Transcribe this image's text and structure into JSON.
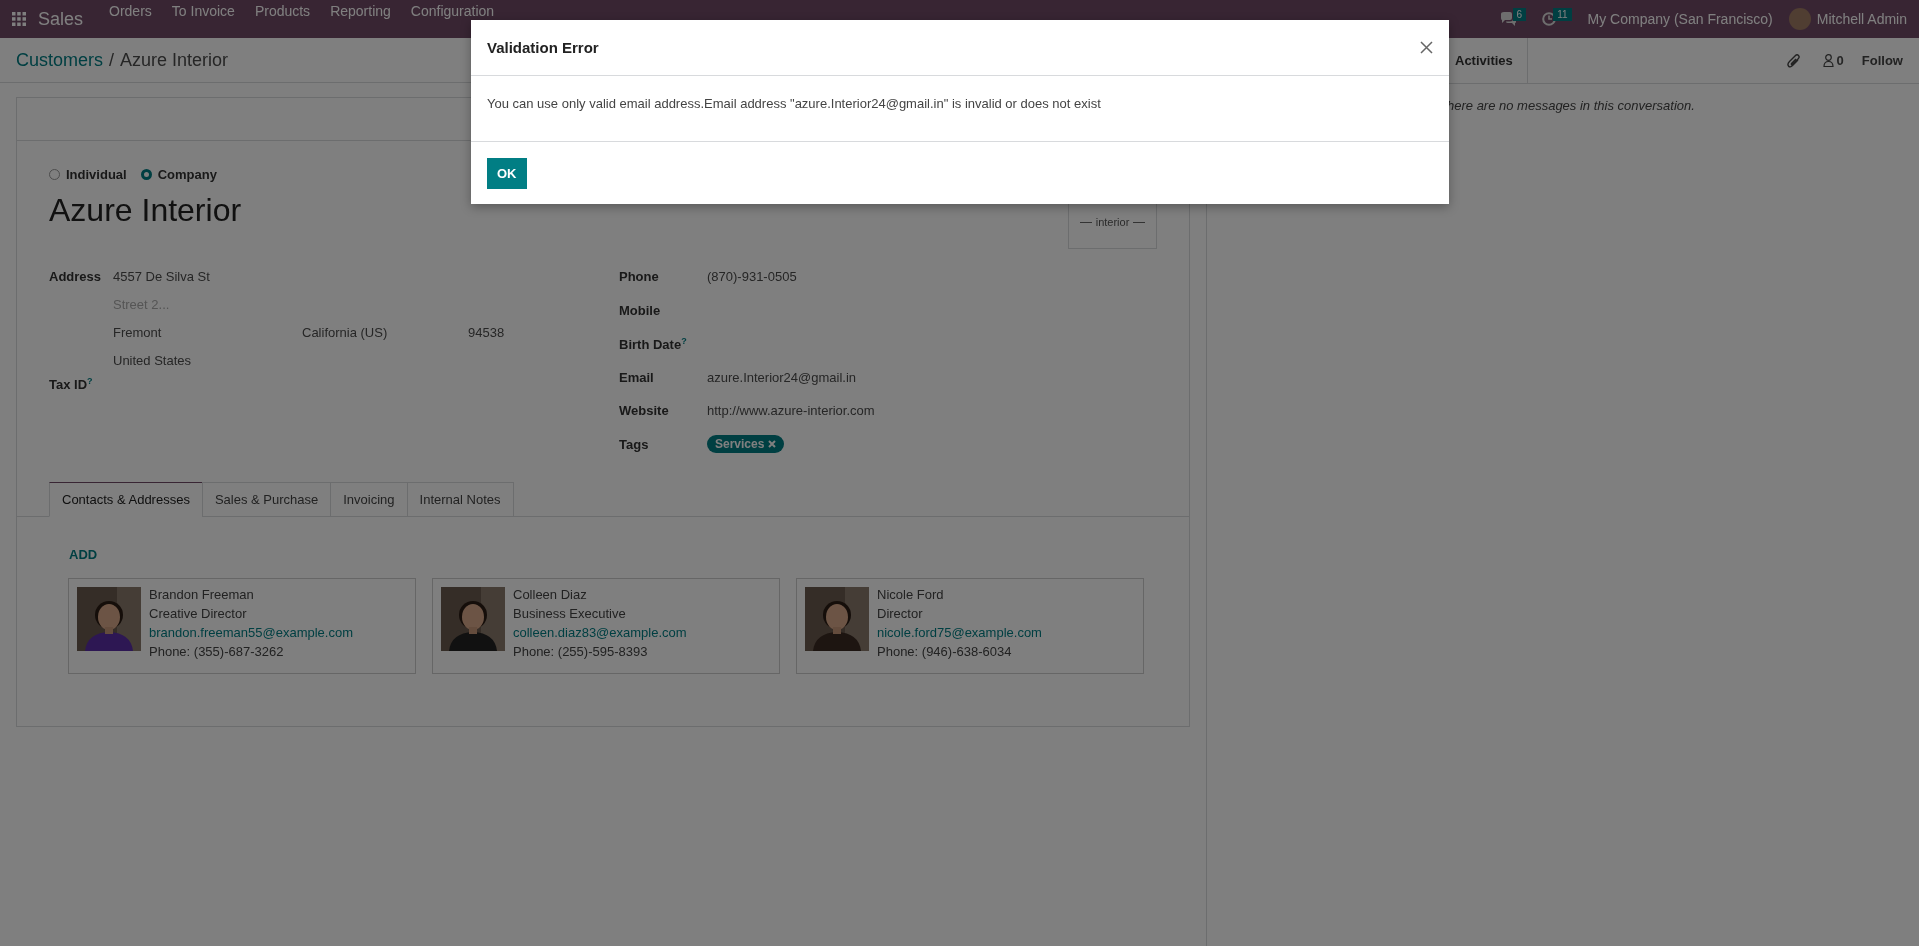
{
  "navbar": {
    "app": "Sales",
    "menu": [
      "Orders",
      "To Invoice",
      "Products",
      "Reporting",
      "Configuration"
    ],
    "messages_badge": "6",
    "activities_badge": "11",
    "company": "My Company (San Francisco)",
    "user": "Mitchell Admin"
  },
  "breadcrumb": {
    "parent": "Customers",
    "separator": "/",
    "current": "Azure Interior"
  },
  "company_type": [
    {
      "label": "Individual",
      "selected": false
    },
    {
      "label": "Company",
      "selected": true
    }
  ],
  "name": "Azure Interior",
  "logo": {
    "tagline": "interior"
  },
  "address": {
    "label": "Address",
    "street": "4557 De Silva St",
    "street2_placeholder": "Street 2...",
    "city": "Fremont",
    "state": "California (US)",
    "zip": "94538",
    "country": "United States"
  },
  "tax_id": {
    "label": "Tax ID$^{?}$"
  },
  "right_fields": [
    {
      "kind": "text",
      "label": "Phone",
      "value": "(870)-931-0505"
    },
    {
      "kind": "text",
      "label": "Mobile"
    },
    {
      "kind": "text",
      "label": "Birth Date$^{?}$"
    },
    {
      "kind": "text",
      "label": "Email",
      "value": "azure.Interior24@gmail.in"
    },
    {
      "kind": "link",
      "label": "Website",
      "value": "http://www.azure-interior.com"
    },
    {
      "kind": "tags",
      "label": "Tags",
      "tags": [
        "Services"
      ]
    }
  ],
  "tabs": [
    {
      "label": "Contacts & Addresses",
      "selected": true
    },
    {
      "label": "Sales & Purchase",
      "selected": false
    },
    {
      "label": "Invoicing",
      "selected": false
    },
    {
      "label": "Internal Notes",
      "selected": false
    }
  ],
  "add_button": "ADD",
  "contacts": [
    {
      "name": "Brandon Freeman",
      "title": "Creative Director",
      "email": "brandon.freeman55@example.com",
      "phone": "Phone: (355)-687-3262"
    },
    {
      "name": "Colleen Diaz",
      "title": "Business Executive",
      "email": "colleen.diaz83@example.com",
      "phone": "Phone: (255)-595-8393"
    },
    {
      "name": "Nicole Ford",
      "title": "Director",
      "email": "nicole.ford75@example.com",
      "phone": "Phone: (946)-638-6034"
    }
  ],
  "chatter": {
    "activities": "Activities",
    "followers": "0",
    "follow": "Follow",
    "empty": "here are no messages in this conversation."
  },
  "dialog": {
    "title": "Validation Error",
    "message": "You can use only valid email address.Email address \"azure.Interior24@gmail.in\" is invalid or does not exist",
    "ok": "OK"
  }
}
